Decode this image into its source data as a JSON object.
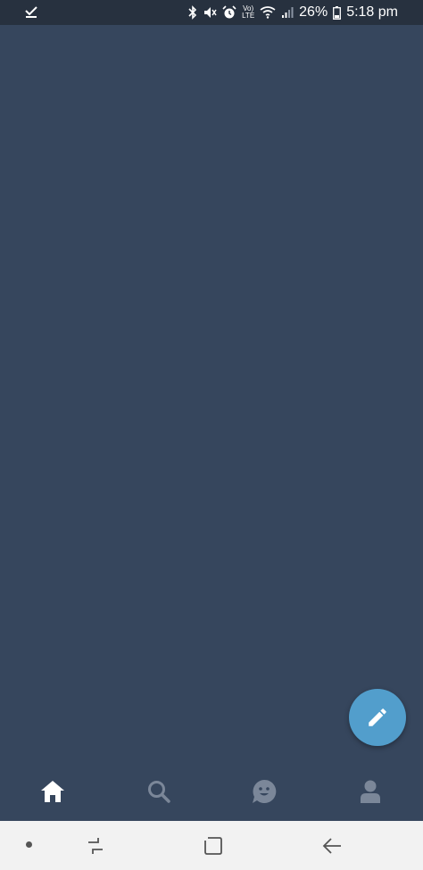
{
  "status_bar": {
    "battery": "26%",
    "time": "5:18 pm",
    "icons": [
      "download-done-icon",
      "bluetooth-icon",
      "mute-icon",
      "alarm-icon",
      "volte-icon",
      "wifi-icon",
      "signal-icon",
      "battery-icon"
    ],
    "volte_top": "Vo)",
    "volte_bottom": "LTE"
  },
  "fab": {
    "icon": "pencil-icon"
  },
  "tabs": [
    {
      "icon": "home-icon",
      "active": true
    },
    {
      "icon": "search-icon",
      "active": false
    },
    {
      "icon": "smiley-icon",
      "active": false
    },
    {
      "icon": "account-icon",
      "active": false
    }
  ],
  "nav_bar": {
    "icons": [
      "dot-icon",
      "recents-icon",
      "home-square-icon",
      "back-icon"
    ]
  },
  "colors": {
    "background": "#36465d",
    "status_bar": "#27313f",
    "fab": "#529ecc",
    "tab_active": "#ffffff",
    "tab_inactive": "#7b8799",
    "nav_bar": "#f2f2f2"
  }
}
